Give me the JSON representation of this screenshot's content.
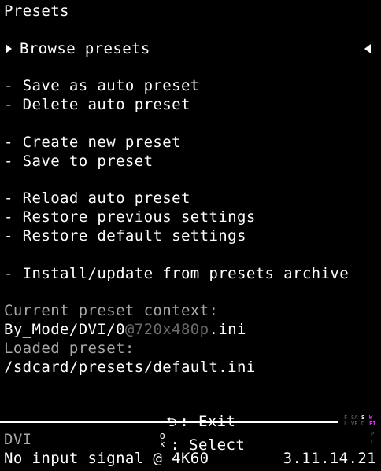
{
  "title": "Presets",
  "menu": {
    "browse": "Browse presets",
    "save_auto": "- Save as auto preset",
    "delete_auto": "- Delete auto preset",
    "create_new": "- Create new preset",
    "save_to": "- Save to preset",
    "reload_auto": "- Reload auto preset",
    "restore_previous": "- Restore previous settings",
    "restore_default": "- Restore default settings",
    "install_update": "- Install/update from presets archive"
  },
  "info": {
    "context_label": "Current preset context:",
    "context_value_a": "By_Mode/DVI/0",
    "context_value_b": "@720x480p",
    "context_value_c": ".ini",
    "loaded_label": "Loaded preset:",
    "loaded_value": "/sdcard/presets/default.ini"
  },
  "footer": {
    "exit_icon": "back-arrow-icon",
    "exit_label": ": Exit",
    "select_icon": "ok-button-icon",
    "select_label": ": Select"
  },
  "status": {
    "input": "DVI",
    "signal": "No input signal @ 4K60",
    "version": "3.11.14.21",
    "flags": {
      "f": "F",
      "sa": "SA",
      "s": "S",
      "w": "W",
      "l": "L",
      "ve": "VE",
      "d": "D",
      "fi": "FI",
      "p": "P",
      "c": "C"
    },
    "highlight_color": "#e040ff"
  }
}
